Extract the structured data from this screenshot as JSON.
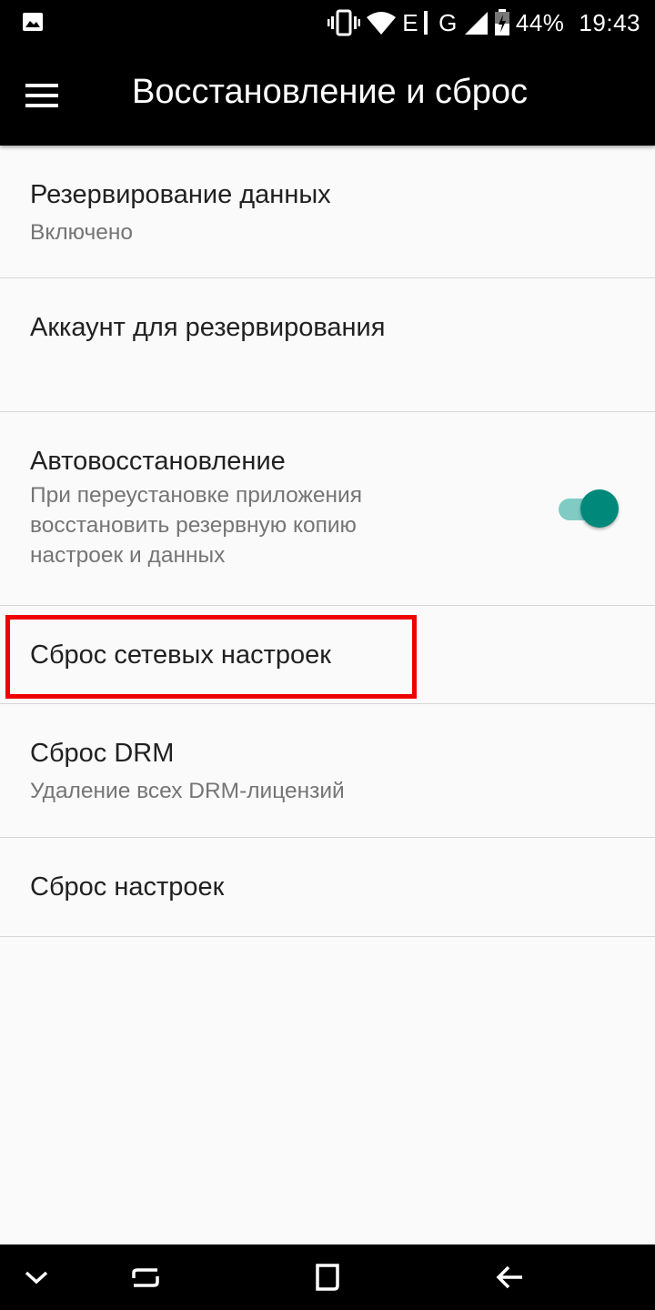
{
  "status_bar": {
    "network_e": "E",
    "network_g": "G",
    "battery": "44%",
    "time": "19:43",
    "icons": [
      "image-icon",
      "vibrate-icon",
      "wifi-icon",
      "signal-icon",
      "battery-icon"
    ]
  },
  "app_bar": {
    "title": "Восстановление и сброс",
    "menu_icon": "hamburger-menu-icon"
  },
  "items": [
    {
      "title": "Резервирование данных",
      "subtitle": "Включено"
    },
    {
      "title": "Аккаунт для резервирования",
      "subtitle": ""
    },
    {
      "title": "Автовосстановление",
      "subtitle": "При переустановке приложения восстановить резервную копию настроек и данных",
      "toggle": true
    },
    {
      "title": "Сброс сетевых настроек",
      "subtitle": ""
    },
    {
      "title": "Сброс DRM",
      "subtitle": "Удаление всех DRM-лицензий"
    },
    {
      "title": "Сброс настроек",
      "subtitle": ""
    }
  ],
  "colors": {
    "accent": "#00897b",
    "accent_track": "#80cbc4",
    "highlight": "#ee0000",
    "bar": "#000000"
  },
  "nav_bar": {
    "icons": [
      "chevron-down-icon",
      "recents-icon",
      "home-icon",
      "back-icon"
    ]
  }
}
